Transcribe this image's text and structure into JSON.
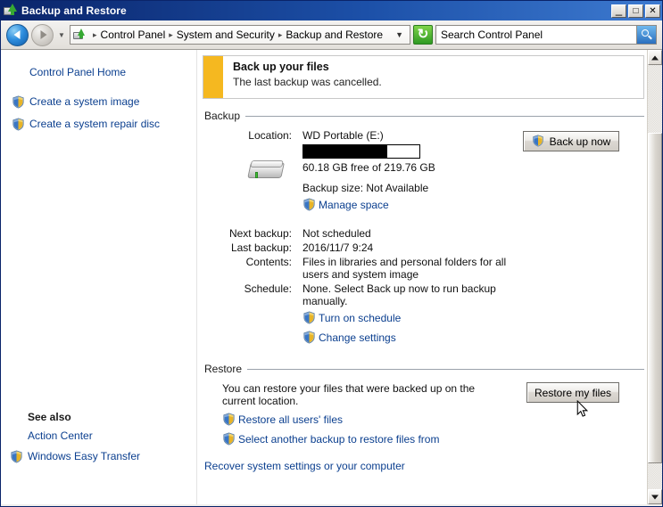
{
  "window": {
    "title": "Backup and Restore",
    "title_icon": "backup-restore-icon",
    "minimize_label": "_",
    "maximize_label": "□",
    "close_label": "✕"
  },
  "navbar": {
    "back_label": "Back",
    "forward_label": "Forward",
    "recent_label": "Recent pages",
    "crumb_icon": "control-panel-icon",
    "breadcrumbs": [
      "Control Panel",
      "System and Security",
      "Backup and Restore"
    ],
    "separator": "▸",
    "dropdown": "▼",
    "refresh_label": "Refresh",
    "search_placeholder": "Search Control Panel",
    "search_value": ""
  },
  "sidebar": {
    "home_label": "Control Panel Home",
    "items": [
      {
        "label": "Create a system image",
        "icon": "shield-icon"
      },
      {
        "label": "Create a system repair disc",
        "icon": "shield-icon"
      }
    ],
    "see_also_heading": "See also",
    "see_also": [
      {
        "label": "Action Center",
        "icon": "none"
      },
      {
        "label": "Windows Easy Transfer",
        "icon": "shield-icon"
      }
    ]
  },
  "banner": {
    "accent_color": "#f5b820",
    "title": "Back up your files",
    "subtitle": "The last backup was cancelled."
  },
  "backup": {
    "section_label": "Backup",
    "location_label": "Location:",
    "drive_icon": "external-hard-drive-icon",
    "drive_name": "WD Portable (E:)",
    "capacity_text": "60.18 GB free of 219.76 GB",
    "used_percent": 72,
    "backup_size_text": "Backup size: Not Available",
    "manage_space_label": "Manage space",
    "backup_now_label": "Back up now",
    "rows": [
      {
        "key": "Next backup:",
        "value": "Not scheduled"
      },
      {
        "key": "Last backup:",
        "value": "2016/11/7 9:24"
      },
      {
        "key": "Contents:",
        "value": "Files in libraries and personal folders for all users and system image"
      },
      {
        "key": "Schedule:",
        "value": "None. Select Back up now to run backup manually."
      }
    ],
    "turn_on_schedule_label": "Turn on schedule",
    "change_settings_label": "Change settings"
  },
  "restore": {
    "section_label": "Restore",
    "description": "You can restore your files that were backed up on the current location.",
    "restore_all_label": "Restore all users' files",
    "select_another_label": "Select another backup to restore files from",
    "recover_label": "Recover system settings or your computer",
    "restore_my_files_label": "Restore my files"
  },
  "scrollbar": {
    "up_label": "Scroll up",
    "down_label": "Scroll down",
    "thumb_label": "Scroll thumb"
  }
}
